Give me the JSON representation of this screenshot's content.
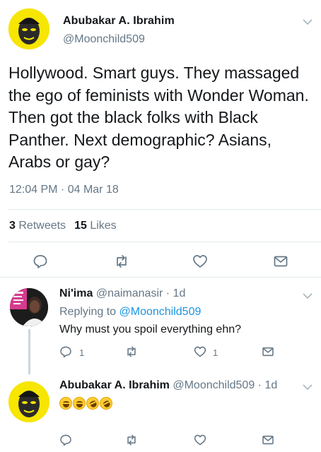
{
  "main_tweet": {
    "display_name": "Abubakar A. Ibrahim",
    "handle": "@Moonchild509",
    "text": "Hollywood. Smart guys. They massaged the ego of feminists with Wonder Woman. Then got the black folks with Black Panther. Next demographic? Asians, Arabs or gay?",
    "timestamp": "12:04 PM · 04 Mar 18",
    "retweets_count": "3",
    "retweets_label": "Retweets",
    "likes_count": "15",
    "likes_label": "Likes",
    "actions": [
      "reply-icon",
      "retweet-icon",
      "like-icon",
      "message-icon"
    ]
  },
  "replies": [
    {
      "display_name": "Ni'ima",
      "handle": "@naimanasir",
      "time": "· 1d",
      "replying_prefix": "Replying to",
      "replying_to": "@Moonchild509",
      "text": "Why must you spoil everything ehn?",
      "reply_count": "1",
      "like_count": "1"
    },
    {
      "display_name": "Abubakar A. Ibrahim",
      "handle": "@Moonchild509",
      "time": "· 1d",
      "emojis": [
        "grinning-sweat",
        "grinning-sweat",
        "rolling-laughing",
        "rolling-laughing"
      ]
    }
  ],
  "colors": {
    "link": "#1b95e0",
    "secondary_text": "#657786",
    "divider": "#e1e8ed",
    "avatar_yellow": "#f6e600"
  }
}
